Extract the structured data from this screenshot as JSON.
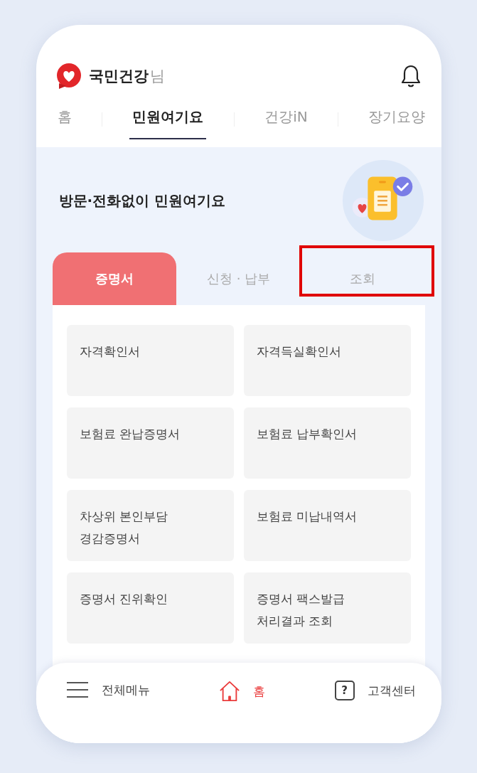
{
  "header": {
    "user_name": "국민건강",
    "honorific": "님"
  },
  "nav_tabs": [
    {
      "label": "홈",
      "selected": false
    },
    {
      "label": "민원여기요",
      "selected": true
    },
    {
      "label": "건강iN",
      "selected": false
    },
    {
      "label": "장기요양",
      "selected": false
    }
  ],
  "banner": {
    "title": "방문·전화없이 민원여기요"
  },
  "segment_tabs": [
    {
      "label": "증명서",
      "selected": true,
      "highlighted": false
    },
    {
      "label": "신청 · 납부",
      "selected": false,
      "highlighted": false
    },
    {
      "label": "조회",
      "selected": false,
      "highlighted": true
    }
  ],
  "documents": [
    {
      "label": "자격확인서"
    },
    {
      "label": "자격득실확인서"
    },
    {
      "label": "보험료 완납증명서"
    },
    {
      "label": "보험료 납부확인서"
    },
    {
      "label": "차상위 본인부담\n경감증명서"
    },
    {
      "label": "보험료 미납내역서"
    },
    {
      "label": "증명서 진위확인"
    },
    {
      "label": "증명서 팩스발급\n처리결과 조회"
    }
  ],
  "bottom_nav": [
    {
      "kind": "menu",
      "label": "전체메뉴",
      "selected": false
    },
    {
      "kind": "home",
      "label": "홈",
      "selected": true
    },
    {
      "kind": "help",
      "label": "고객센터",
      "icon_glyph": "?",
      "selected": false
    }
  ]
}
